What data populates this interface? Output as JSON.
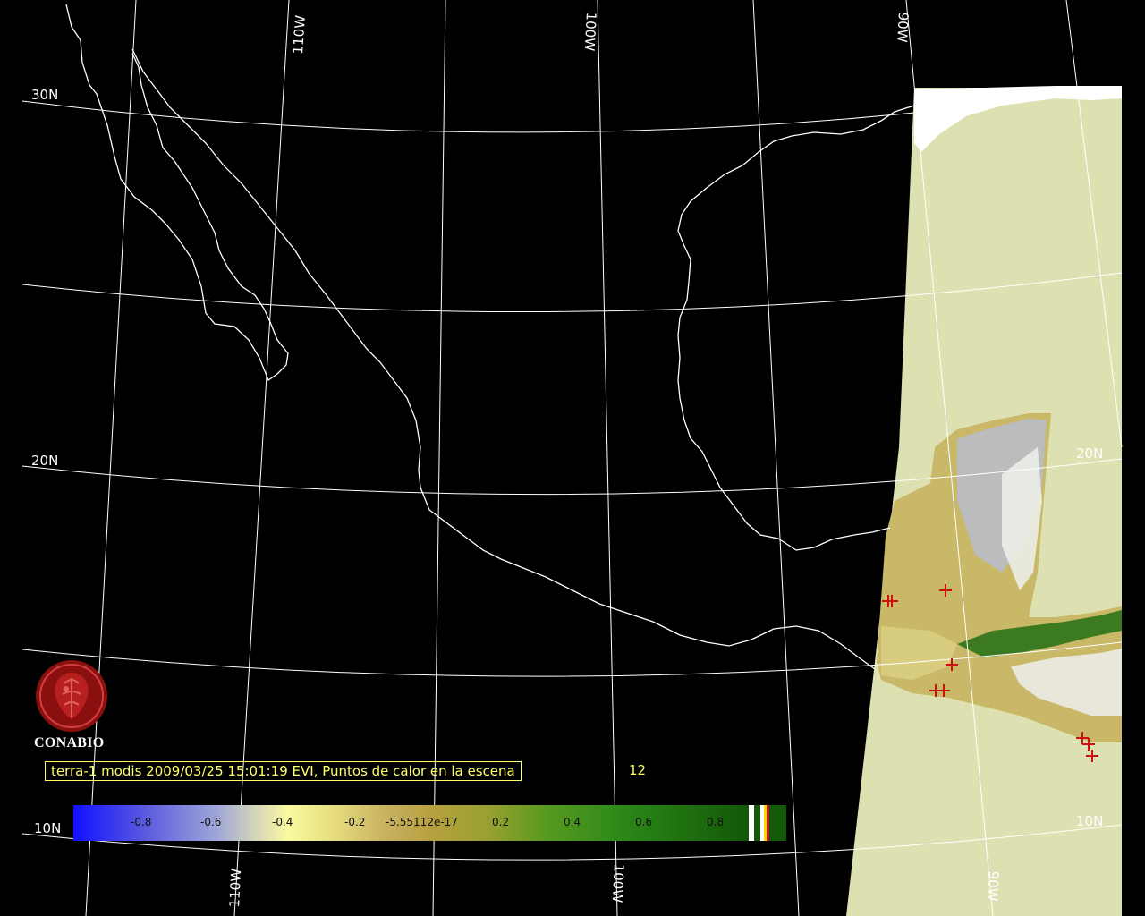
{
  "map": {
    "latitude_labels_left": [
      "30N",
      "20N",
      "10N"
    ],
    "latitude_labels_right": [
      "20N",
      "10N"
    ],
    "longitude_labels_top": [
      "110W",
      "100W",
      "90W"
    ],
    "longitude_labels_bottom": [
      "110W",
      "100W",
      "90W"
    ],
    "hotspot_count_markers": 9,
    "colors": {
      "background": "#000000",
      "coastline": "#ffffff",
      "graticule": "#ffffff",
      "scene_background": "#dde0b0",
      "hotspot_marker": "#cc1010",
      "caption_text": "#ffff66"
    }
  },
  "caption": {
    "text": "terra-1 modis 2009/03/25 15:01:19 EVI, Puntos de calor en la escena",
    "count": "12"
  },
  "logo": {
    "name": "CONABIO",
    "icon": "conabio-seal-icon"
  },
  "colorbar": {
    "ticks": [
      "-0.8",
      "-0.6",
      "-0.4",
      "-0.2",
      "-5.55112e-17",
      "0.2",
      "0.4",
      "0.6",
      "0.8"
    ],
    "range": [
      -1,
      1
    ]
  }
}
